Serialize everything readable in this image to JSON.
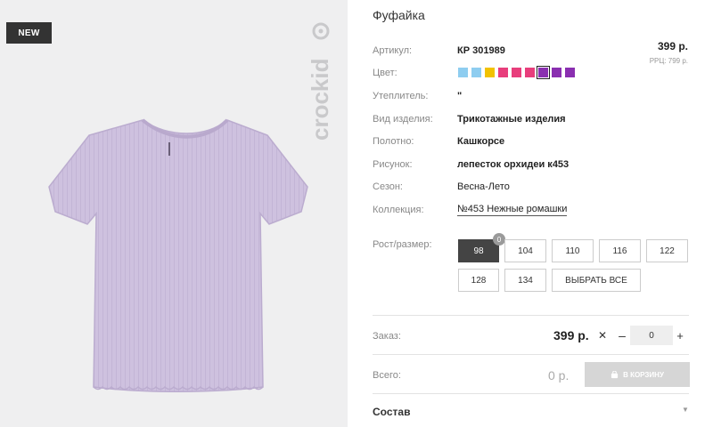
{
  "badge": "NEW",
  "brand": "crockid",
  "product": {
    "title": "Фуфайка",
    "price": "399 р.",
    "rrp": "РРЦ: 799 р."
  },
  "attributes": {
    "article": {
      "label": "Артикул:",
      "value": "КР 301989"
    },
    "color": {
      "label": "Цвет:"
    },
    "insulation": {
      "label": "Утеплитель:",
      "value": "\""
    },
    "type": {
      "label": "Вид изделия:",
      "value": "Трикотажные изделия"
    },
    "fabric": {
      "label": "Полотно:",
      "value": "Кашкорсе"
    },
    "pattern": {
      "label": "Рисунок:",
      "value": "лепесток орхидеи к453"
    },
    "season": {
      "label": "Сезон:",
      "value": "Весна-Лето"
    },
    "collection": {
      "label": "Коллекция:",
      "value": "№453 Нежные ромашки"
    }
  },
  "swatches": [
    {
      "color": "#8ecdf0",
      "selected": false
    },
    {
      "color": "#8ecdf0",
      "selected": false
    },
    {
      "color": "#f2c200",
      "selected": false
    },
    {
      "color": "#e83e7c",
      "selected": false
    },
    {
      "color": "#e83e7c",
      "selected": false
    },
    {
      "color": "#e83e7c",
      "selected": false
    },
    {
      "color": "#8a2fb0",
      "selected": true
    },
    {
      "color": "#8a2fb0",
      "selected": false
    },
    {
      "color": "#8a2fb0",
      "selected": false
    }
  ],
  "sizes": {
    "label": "Рост/размер:",
    "count_badge": "0",
    "options": [
      "98",
      "104",
      "110",
      "116",
      "122",
      "128",
      "134"
    ],
    "selected": "98",
    "select_all": "ВЫБРАТЬ ВСЕ"
  },
  "order": {
    "label": "Заказ:",
    "price": "399 р.",
    "times": "✕",
    "minus": "–",
    "quantity": "0",
    "plus": "+"
  },
  "total": {
    "label": "Всего:",
    "value": "0 р.",
    "cart_button": "В КОРЗИНУ"
  },
  "composition": {
    "label": "Состав"
  },
  "colors": {
    "image_bg": "#efeff0",
    "shirt": "#cec1df",
    "active_size": "#444444",
    "cart_disabled": "#d6d6d6"
  }
}
